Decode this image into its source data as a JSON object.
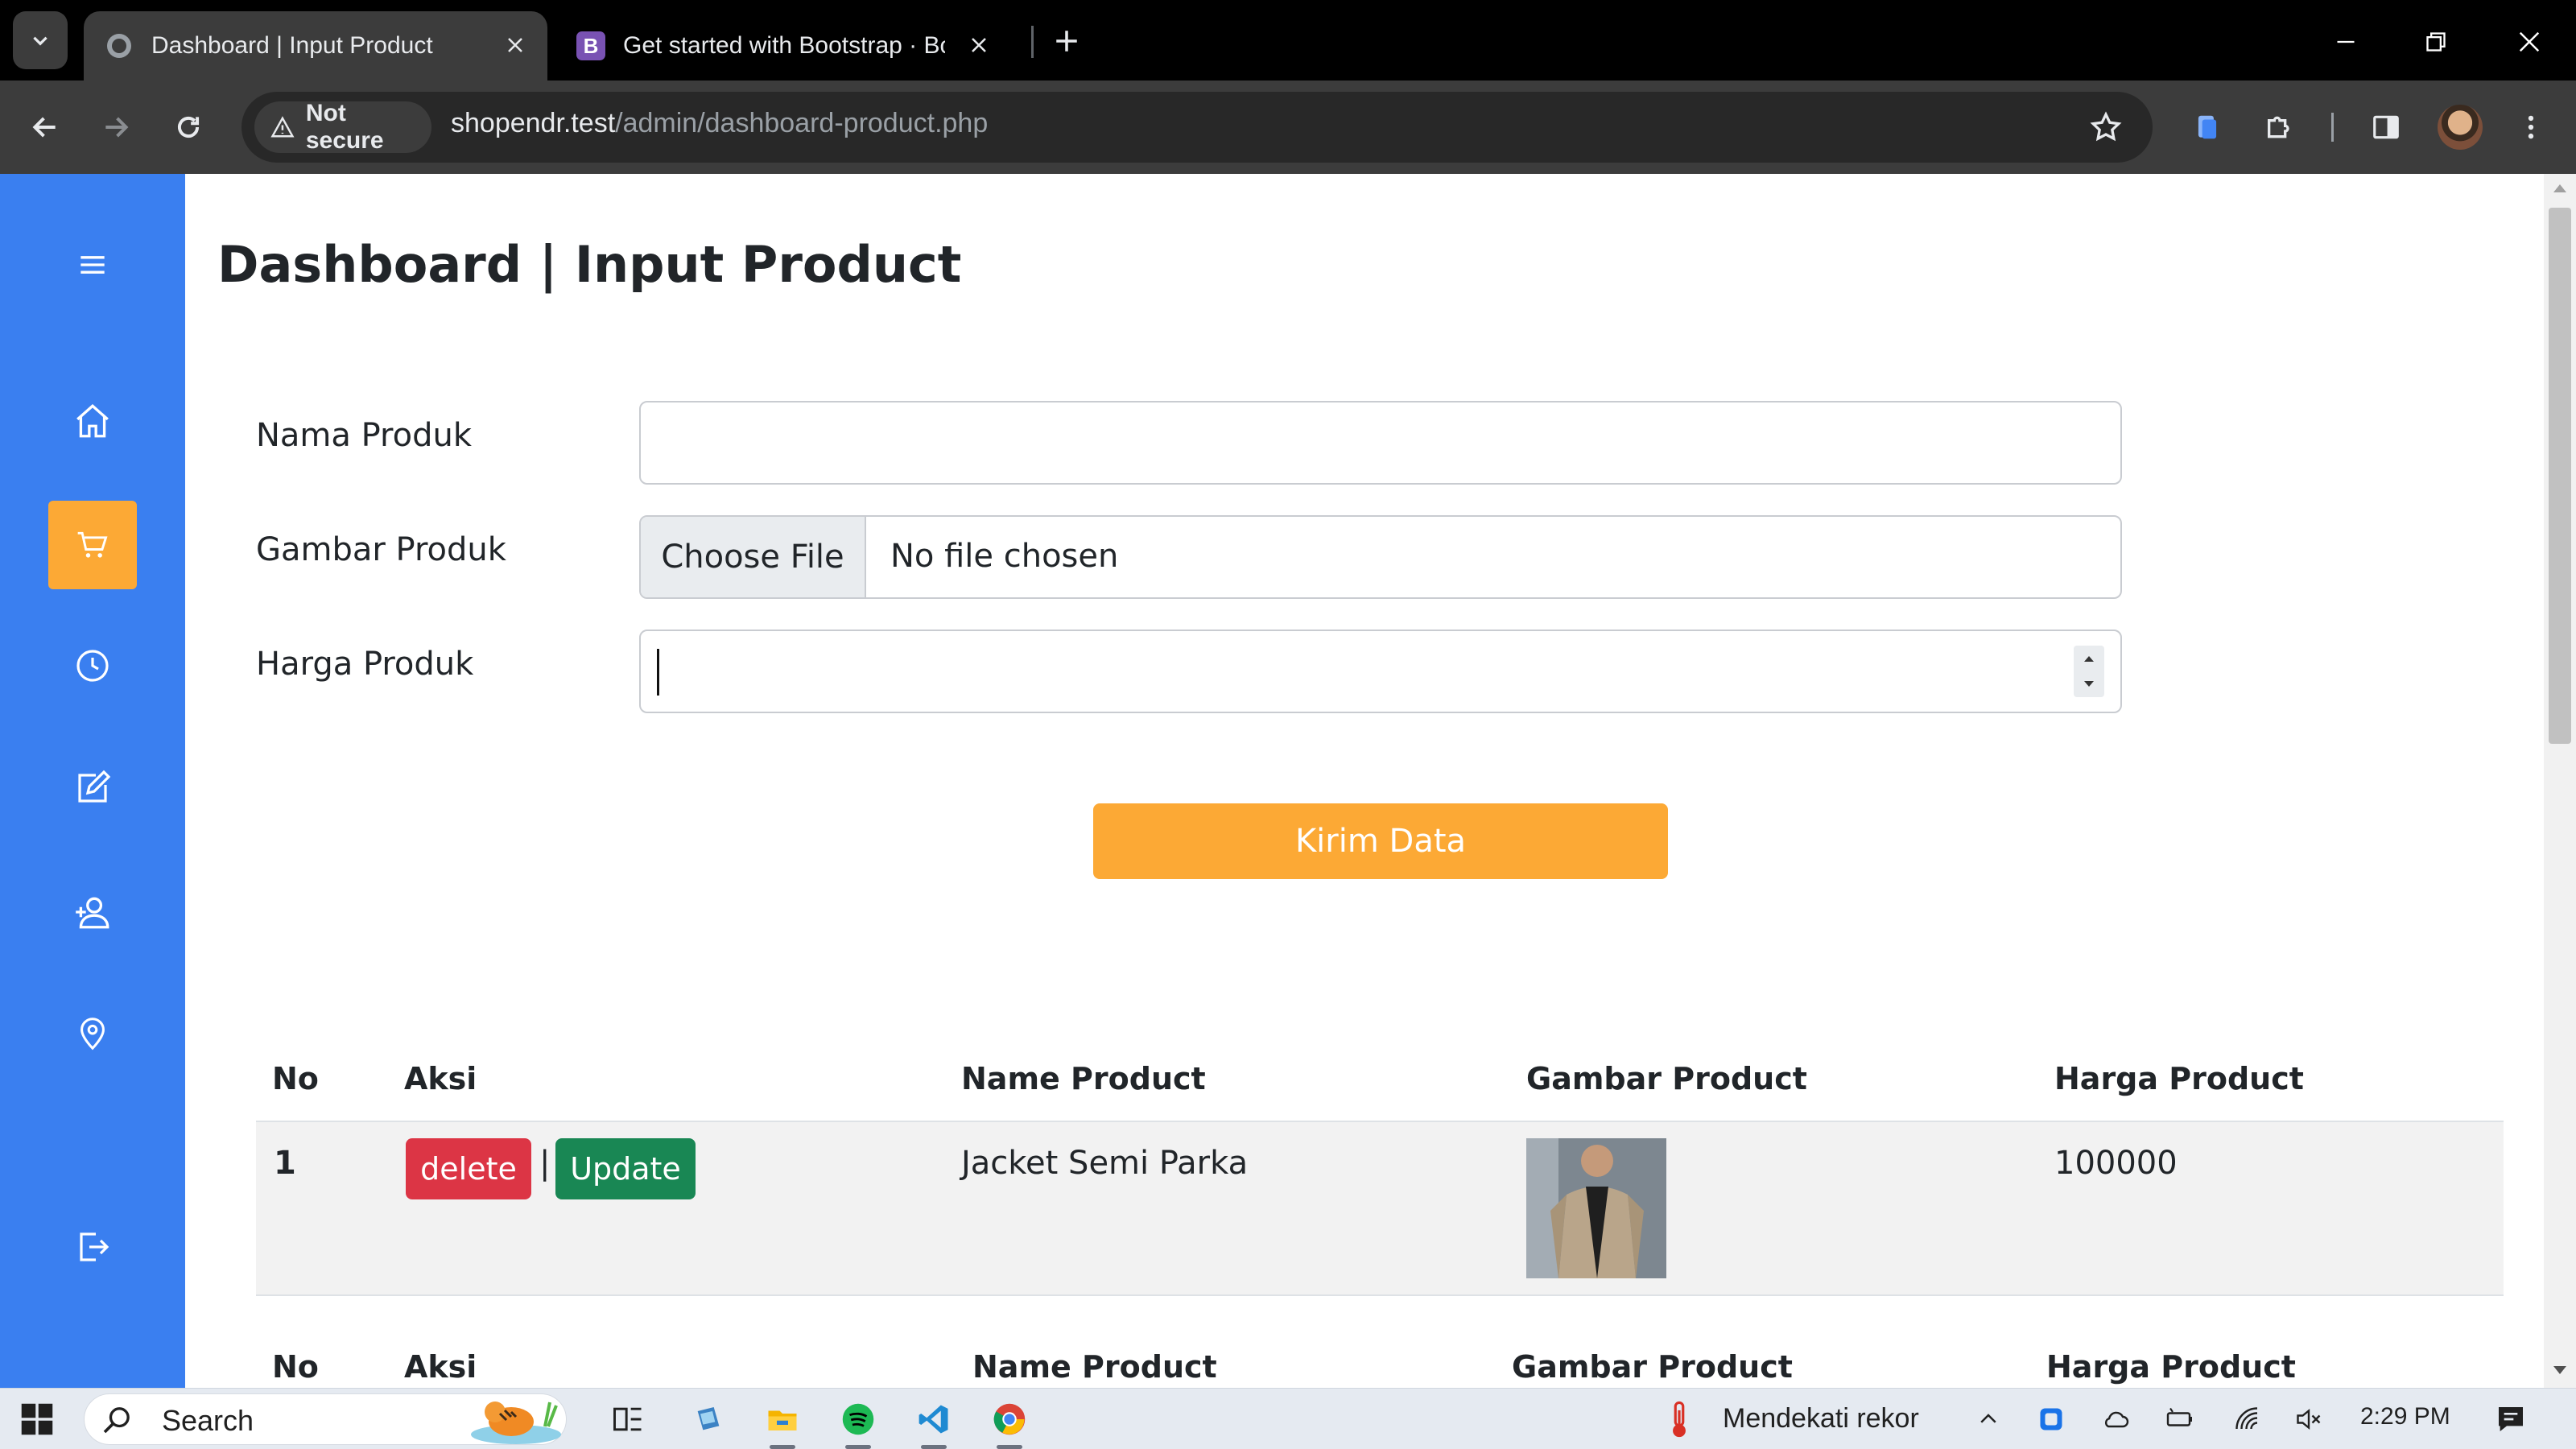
{
  "browser": {
    "tabs": [
      {
        "title": "Dashboard | Input Product",
        "active": true
      },
      {
        "title": "Get started with Bootstrap · Boo",
        "active": false,
        "favicon_letter": "B"
      }
    ],
    "security_label": "Not secure",
    "url_host": "shopendr.test",
    "url_path": "/admin/dashboard-product.php"
  },
  "sidebar": {
    "items": [
      {
        "icon": "menu-icon"
      },
      {
        "icon": "home-icon"
      },
      {
        "icon": "cart-icon",
        "active": true
      },
      {
        "icon": "clock-icon"
      },
      {
        "icon": "edit-icon"
      },
      {
        "icon": "user-add-icon"
      },
      {
        "icon": "location-icon"
      },
      {
        "icon": "logout-icon"
      }
    ]
  },
  "page": {
    "title": "Dashboard | Input Product"
  },
  "form": {
    "nama_label": "Nama Produk",
    "nama_value": "",
    "gambar_label": "Gambar Produk",
    "file_button": "Choose File",
    "file_status": "No file chosen",
    "harga_label": "Harga Produk",
    "harga_value": "",
    "submit_label": "Kirim Data"
  },
  "table": {
    "headers": [
      "No",
      "Aksi",
      "Name Product",
      "Gambar Product",
      "Harga Product"
    ],
    "rows": [
      {
        "no": "1",
        "delete_label": "delete",
        "separator": "|",
        "update_label": "Update",
        "name": "Jacket Semi Parka",
        "price": "100000"
      }
    ],
    "footer_headers": [
      "No",
      "Aksi",
      "Name Product",
      "Gambar Product",
      "Harga Product"
    ]
  },
  "taskbar": {
    "search_label": "Search",
    "weather_text": "Mendekati rekor",
    "time": "2:29 PM"
  },
  "colors": {
    "sidebar": "#3a7ff0",
    "accent": "#fca935",
    "danger": "#dc3545",
    "success": "#198754"
  }
}
